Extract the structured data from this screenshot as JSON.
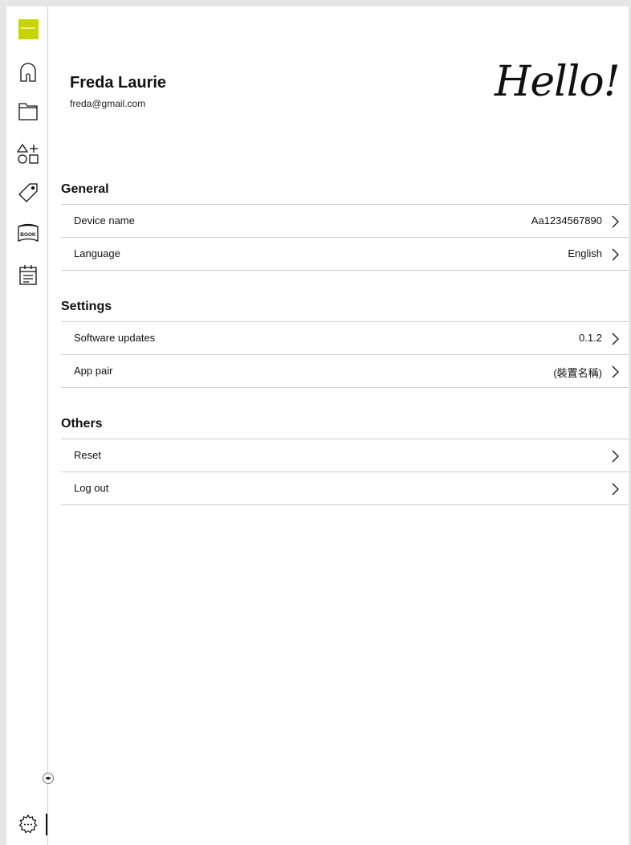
{
  "sidebar": {
    "items": [
      {
        "name": "home-icon"
      },
      {
        "name": "folder-icon"
      },
      {
        "name": "shapes-icon"
      },
      {
        "name": "tag-icon"
      },
      {
        "name": "book-icon",
        "text": "BOOK"
      },
      {
        "name": "calendar-icon"
      }
    ],
    "settings_icon": "gear-icon"
  },
  "profile": {
    "name": "Freda Laurie",
    "email": "freda@gmail.com",
    "greeting": "Hello!"
  },
  "sections": [
    {
      "title": "General",
      "rows": [
        {
          "label": "Device name",
          "value": "Aa1234567890"
        },
        {
          "label": "Language",
          "value": "English"
        }
      ]
    },
    {
      "title": "Settings",
      "rows": [
        {
          "label": "Software updates",
          "value": "0.1.2"
        },
        {
          "label": "App pair",
          "value": "(裝置名稱)"
        }
      ]
    },
    {
      "title": "Others",
      "rows": [
        {
          "label": "Reset",
          "value": ""
        },
        {
          "label": "Log out",
          "value": ""
        }
      ]
    }
  ],
  "colors": {
    "brand": "#c8d400",
    "divider": "#cfcfcf",
    "text": "#111111"
  }
}
